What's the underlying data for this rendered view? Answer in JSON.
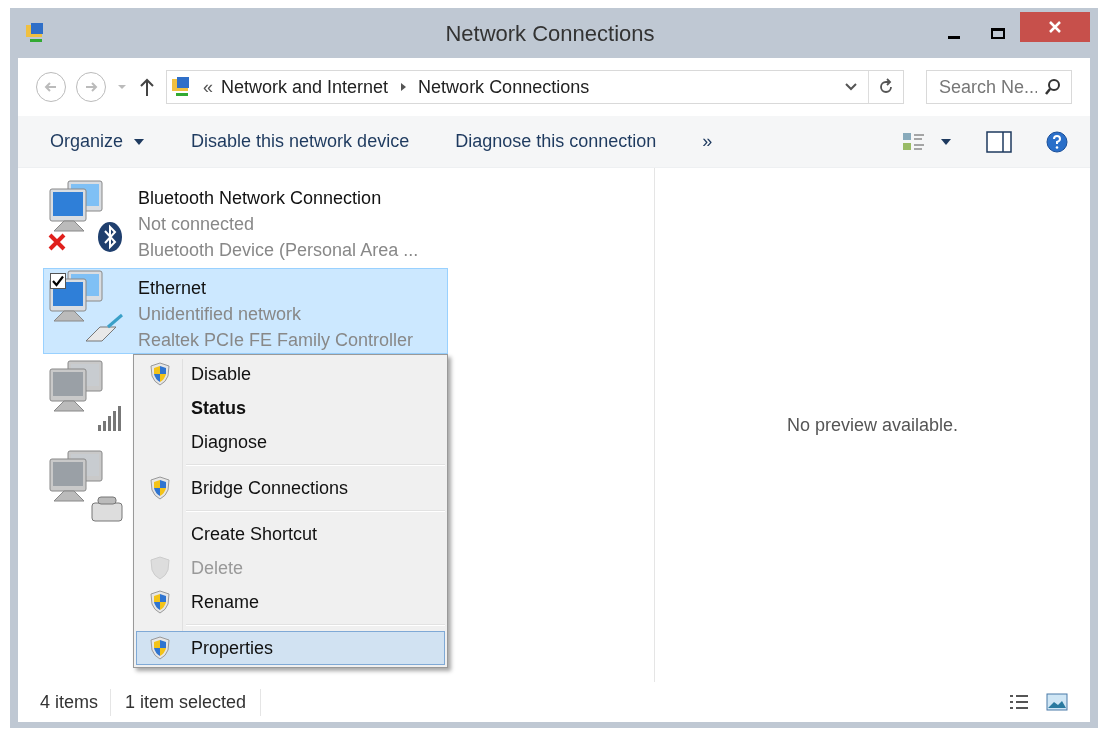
{
  "window": {
    "title": "Network Connections"
  },
  "address": {
    "crumbs": [
      "Network and Internet",
      "Network Connections"
    ],
    "overflow": "«",
    "search_placeholder": "Search Ne..."
  },
  "toolbar": {
    "items": [
      {
        "label": "Organize",
        "dropdown": true
      },
      {
        "label": "Disable this network device",
        "dropdown": false
      },
      {
        "label": "Diagnose this connection",
        "dropdown": false
      },
      {
        "label": "»",
        "dropdown": false
      }
    ]
  },
  "connections": [
    {
      "kind": "bluetooth",
      "name": "Bluetooth Network Connection",
      "status": "Not connected",
      "device": "Bluetooth Device (Personal Area ...",
      "selected": false,
      "disconnected": true,
      "disabled": false
    },
    {
      "kind": "ethernet",
      "name": "Ethernet",
      "status": "Unidentified network",
      "device": "Realtek PCIe FE Family Controller",
      "selected": true,
      "disconnected": false,
      "disabled": false
    },
    {
      "kind": "wireless",
      "selected": false,
      "disconnected": false,
      "disabled": true
    },
    {
      "kind": "dialup",
      "selected": false,
      "disconnected": false,
      "disabled": true
    }
  ],
  "context_menu": [
    {
      "kind": "item",
      "label": "Disable",
      "shield": true,
      "bold": false,
      "disabled": false,
      "selected": false
    },
    {
      "kind": "item",
      "label": "Status",
      "shield": false,
      "bold": true,
      "disabled": false,
      "selected": false
    },
    {
      "kind": "item",
      "label": "Diagnose",
      "shield": false,
      "bold": false,
      "disabled": false,
      "selected": false
    },
    {
      "kind": "separator"
    },
    {
      "kind": "item",
      "label": "Bridge Connections",
      "shield": true,
      "bold": false,
      "disabled": false,
      "selected": false
    },
    {
      "kind": "separator"
    },
    {
      "kind": "item",
      "label": "Create Shortcut",
      "shield": false,
      "bold": false,
      "disabled": false,
      "selected": false
    },
    {
      "kind": "item",
      "label": "Delete",
      "shield": true,
      "bold": false,
      "disabled": true,
      "selected": false
    },
    {
      "kind": "item",
      "label": "Rename",
      "shield": true,
      "bold": false,
      "disabled": false,
      "selected": false
    },
    {
      "kind": "separator"
    },
    {
      "kind": "item",
      "label": "Properties",
      "shield": true,
      "bold": false,
      "disabled": false,
      "selected": true
    }
  ],
  "preview": {
    "message": "No preview available."
  },
  "status_bar": {
    "count": "4 items",
    "selection": "1 item selected"
  }
}
